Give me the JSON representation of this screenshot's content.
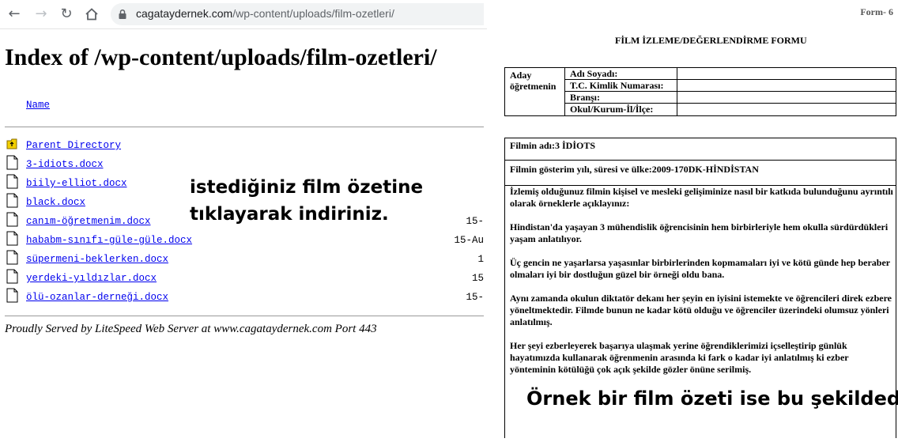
{
  "browser": {
    "url_host": "cagataydernek.com",
    "url_path": "/wp-content/uploads/film-ozetleri/"
  },
  "listing": {
    "title": "Index of /wp-content/uploads/film-ozetleri/",
    "name_header": "Name",
    "files": [
      {
        "name": "Parent Directory",
        "date": "",
        "icon": "folder-up-icon"
      },
      {
        "name": "3-idiots.docx",
        "date": "",
        "icon": "file-icon"
      },
      {
        "name": "biily-elliot.docx",
        "date": "",
        "icon": "file-icon"
      },
      {
        "name": "black.docx",
        "date": "",
        "icon": "file-icon"
      },
      {
        "name": "canım-öğretmenim.docx",
        "date": "15-",
        "icon": "file-icon"
      },
      {
        "name": "hababm-sınıfı-güle-güle.docx",
        "date": "15-Au",
        "icon": "file-icon"
      },
      {
        "name": "süpermeni-beklerken.docx",
        "date": "1",
        "icon": "file-icon"
      },
      {
        "name": "yerdeki-yıldızlar.docx",
        "date": "15",
        "icon": "file-icon"
      },
      {
        "name": "ölü-ozanlar-derneği.docx",
        "date": "15-",
        "icon": "file-icon"
      }
    ],
    "footer": "Proudly Served by LiteSpeed Web Server at www.cagataydernek.com Port 443"
  },
  "overlay_left": {
    "line1": "istediğiniz film özetine",
    "line2": "tıklayarak indiriniz."
  },
  "form": {
    "corner_label": "Form- 6",
    "title": "FİLM İZLEME/DEĞERLENDİRME FORMU",
    "candidate_label": "Aday öğretmenin",
    "fields": [
      "Adı Soyadı:",
      "T.C. Kimlik Numarası:",
      "Branşı:",
      "Okul/Kurum-İl/İlçe:"
    ],
    "film_name": "Filmin adı:3 İDİOTS",
    "film_info": "Filmin gösterim yılı, süresi ve ülke:2009-170DK-HİNDİSTAN",
    "paragraphs": [
      "İzlemiş olduğunuz filmin kişisel ve mesleki gelişiminize nasıl bir katkıda bulunduğunu ayrıntılı olarak örneklerle açıklayınız:",
      "Hindistan'da yaşayan 3 mühendislik öğrencisinin hem birbirleriyle hem okulla sürdürdükleri yaşam anlatılıyor.",
      "Üç gencin ne yaşarlarsa yaşasınlar birbirlerinden kopmamaları iyi ve kötü günde hep beraber olmaları iyi bir dostluğun güzel bir örneği oldu bana.",
      "Aynı zamanda okulun diktatör dekanı her şeyin en iyisini istemekte ve öğrencileri direk ezbere yöneltmektedir. Filmde bunun ne kadar  kötü olduğu ve öğrenciler üzerindeki olumsuz yönleri anlatılmış.",
      "Her şeyi ezberleyerek başarıya ulaşmak yerine öğrendiklerimizi içselleştirip günlük hayatımızda kullanarak öğrenmenin arasında ki  fark o kadar iyi anlatılmış ki ezber yönteminin kötülüğü çok açık şekilde gözler önüne serilmiş."
    ]
  },
  "overlay_right": "Örnek bir film özeti ise bu şekildedir."
}
